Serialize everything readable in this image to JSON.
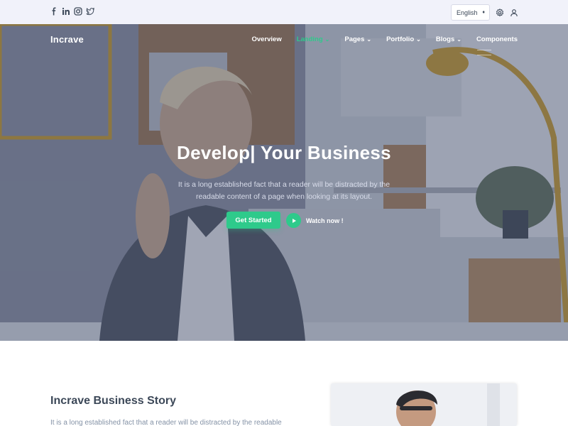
{
  "topbar": {
    "social_icons": [
      "facebook-icon",
      "linkedin-icon",
      "instagram-icon",
      "twitter-icon"
    ],
    "language": {
      "selected": "English"
    },
    "icons": [
      "settings-icon",
      "user-icon"
    ]
  },
  "navbar": {
    "brand": "Incrave",
    "items": [
      {
        "label": "Overview",
        "has_dropdown": false,
        "active": false
      },
      {
        "label": "Landing",
        "has_dropdown": true,
        "active": true
      },
      {
        "label": "Pages",
        "has_dropdown": true,
        "active": false
      },
      {
        "label": "Portfolio",
        "has_dropdown": true,
        "active": false
      },
      {
        "label": "Blogs",
        "has_dropdown": true,
        "active": false
      },
      {
        "label": "Components",
        "has_dropdown": false,
        "active": false
      }
    ]
  },
  "hero": {
    "title": "Develop| Your Business",
    "text_line1": "It is a long established fact that a reader will be distracted by the",
    "text_line2": "readable content of a page when looking at its layout.",
    "cta_label": "Get Started",
    "watch_label": "Watch now !"
  },
  "story": {
    "title": "Incrave Business Story",
    "text": "It is a long established fact that a reader will be distracted by the readable"
  },
  "colors": {
    "accent": "#2eca8b",
    "topbar_bg": "#f1f2fa",
    "text_dark": "#3c4858",
    "text_muted": "#8492a6"
  }
}
